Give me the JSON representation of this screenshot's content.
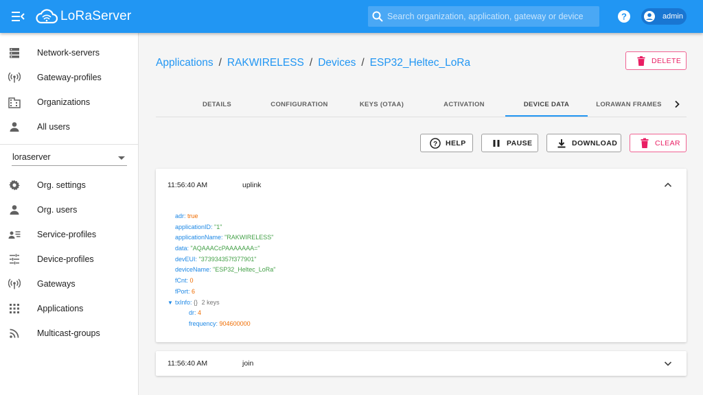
{
  "header": {
    "logo_text": "LoRaServer",
    "search_placeholder": "Search organization, application, gateway or device",
    "username": "admin"
  },
  "sidebar": {
    "top_items": [
      {
        "label": "Network-servers",
        "icon": "server-icon"
      },
      {
        "label": "Gateway-profiles",
        "icon": "radio-tower-icon"
      },
      {
        "label": "Organizations",
        "icon": "building-icon"
      },
      {
        "label": "All users",
        "icon": "person-icon"
      }
    ],
    "org_selector": "loraserver",
    "org_items": [
      {
        "label": "Org. settings",
        "icon": "gear-icon"
      },
      {
        "label": "Org. users",
        "icon": "person-icon"
      },
      {
        "label": "Service-profiles",
        "icon": "account-details-icon"
      },
      {
        "label": "Device-profiles",
        "icon": "tune-icon"
      },
      {
        "label": "Gateways",
        "icon": "radio-tower-icon"
      },
      {
        "label": "Applications",
        "icon": "apps-grid-icon"
      },
      {
        "label": "Multicast-groups",
        "icon": "rss-icon"
      }
    ]
  },
  "breadcrumb": {
    "items": [
      "Applications",
      "RAKWIRELESS",
      "Devices",
      "ESP32_Heltec_LoRa"
    ],
    "separator": "/"
  },
  "delete_button": "DELETE",
  "tabs": {
    "items": [
      "DETAILS",
      "CONFIGURATION",
      "KEYS (OTAA)",
      "ACTIVATION",
      "DEVICE DATA",
      "LORAWAN FRAMES"
    ],
    "active": "DEVICE DATA"
  },
  "toolbar": {
    "help": "HELP",
    "pause": "PAUSE",
    "download": "DOWNLOAD",
    "clear": "CLEAR"
  },
  "events": [
    {
      "time": "11:56:40 AM",
      "type": "uplink",
      "expanded": true,
      "fields": [
        {
          "key": "adr",
          "value": "true",
          "kind": "bool"
        },
        {
          "key": "applicationID",
          "value": "\"1\"",
          "kind": "string"
        },
        {
          "key": "applicationName",
          "value": "\"RAKWIRELESS\"",
          "kind": "string"
        },
        {
          "key": "data",
          "value": "\"AQAAACcPAAAAAAA=\"",
          "kind": "string"
        },
        {
          "key": "devEUI",
          "value": "\"373934357f377901\"",
          "kind": "string"
        },
        {
          "key": "deviceName",
          "value": "\"ESP32_Heltec_LoRa\"",
          "kind": "string"
        },
        {
          "key": "fCnt",
          "value": "0",
          "kind": "number"
        },
        {
          "key": "fPort",
          "value": "6",
          "kind": "number"
        }
      ],
      "nested": {
        "key": "txInfo",
        "brace": "{}",
        "count": "2 keys",
        "fields": [
          {
            "key": "dr",
            "value": "4",
            "kind": "number"
          },
          {
            "key": "frequency",
            "value": "904600000",
            "kind": "number"
          }
        ]
      }
    },
    {
      "time": "11:56:40 AM",
      "type": "join",
      "expanded": false
    }
  ],
  "colors": {
    "primary": "#2196f3",
    "danger": "#e91e63",
    "json_key": "#1e88e5",
    "json_string": "#43a047",
    "json_number": "#ef6c00"
  }
}
